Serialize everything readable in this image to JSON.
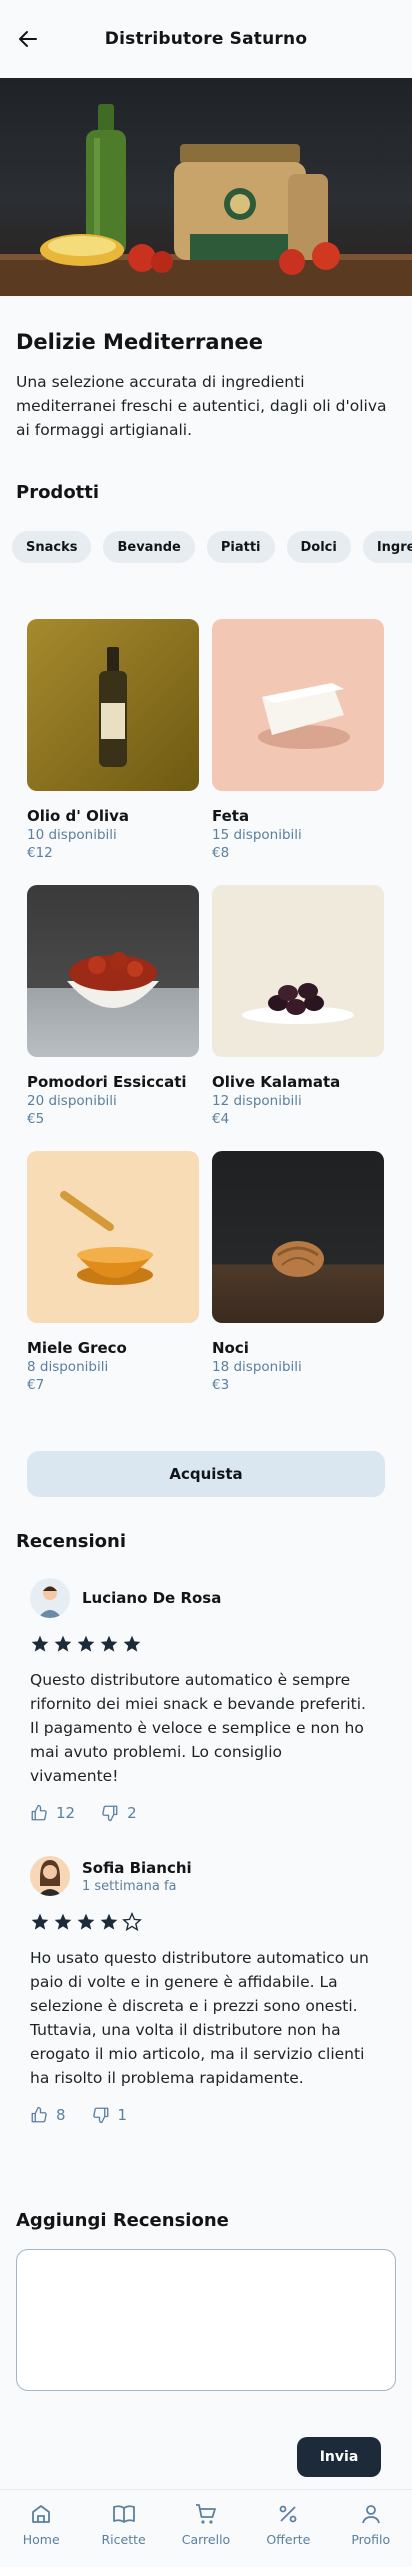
{
  "header": {
    "title": "Distributore Saturno"
  },
  "intro": {
    "title": "Delizie Mediterranee",
    "text": "Una selezione accurata di ingredienti mediterranei freschi e autentici, dagli oli d'oliva ai formaggi artigianali."
  },
  "products_section": {
    "title": "Prodotti"
  },
  "categories": [
    "Snacks",
    "Bevande",
    "Piatti",
    "Dolci",
    "Ingredienti"
  ],
  "products": [
    {
      "name": "Olio d' Oliva",
      "stock": "10 disponibili",
      "price": "€12"
    },
    {
      "name": "Feta",
      "stock": "15 disponibili",
      "price": "€8"
    },
    {
      "name": "Pomodori Essiccati",
      "stock": "20 disponibili",
      "price": "€5"
    },
    {
      "name": "Olive Kalamata",
      "stock": "12 disponibili",
      "price": "€4"
    },
    {
      "name": "Miele Greco",
      "stock": "8 disponibili",
      "price": "€7"
    },
    {
      "name": "Noci",
      "stock": "18 disponibili",
      "price": "€3"
    }
  ],
  "buy_button": "Acquista",
  "reviews_section": {
    "title": "Recensioni",
    "reviews": [
      {
        "name": "Luciano De Rosa",
        "time": "",
        "rating": 5,
        "text": "Questo distributore automatico è sempre rifornito dei miei snack e bevande preferiti. Il pagamento è veloce e semplice e non ho mai avuto problemi. Lo consiglio vivamente!",
        "likes": "12",
        "dislikes": "2"
      },
      {
        "name": "Sofia Bianchi",
        "time": "1 settimana fa",
        "rating": 4,
        "text": "Ho usato questo distributore automatico un paio di volte e in genere è affidabile. La selezione è discreta e i prezzi sono onesti. Tuttavia, una volta il distributore non ha erogato il mio articolo, ma il servizio clienti ha risolto il problema rapidamente.",
        "likes": "8",
        "dislikes": "1"
      }
    ]
  },
  "add_review": {
    "title": "Aggiungi Recensione",
    "placeholder": "",
    "send_label": "Invia"
  },
  "nav": [
    {
      "label": "Home",
      "icon": "home-icon"
    },
    {
      "label": "Ricette",
      "icon": "book-icon"
    },
    {
      "label": "Carrello",
      "icon": "cart-icon"
    },
    {
      "label": "Offerte",
      "icon": "percent-icon"
    },
    {
      "label": "Profilo",
      "icon": "user-icon"
    }
  ],
  "colors": {
    "accent_text": "#5b80a0",
    "chip_bg": "#e6ecf0",
    "buy_bg": "#dae7f0",
    "send_bg": "#1c2a3a",
    "page_bg": "#f8fafb"
  }
}
